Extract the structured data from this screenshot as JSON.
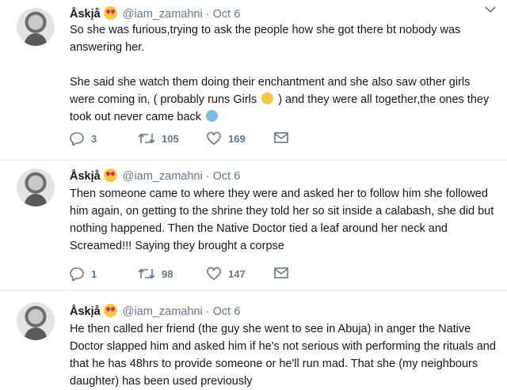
{
  "tweets": [
    {
      "name": "Åskįå",
      "handle": "@iam_zamahni",
      "dot": "·",
      "date": "Oct 6",
      "text1": "So she was furious,trying to ask the people how she got there bt nobody was answering her.",
      "text2a": "She said she watch them doing their enchantment and she also saw other girls were coming in, ( probably runs Girls",
      "text2b": ") and they were all together,the ones they took out never came back",
      "replies": "3",
      "retweets": "105",
      "likes": "169"
    },
    {
      "name": "Åskįå",
      "handle": "@iam_zamahni",
      "dot": "·",
      "date": "Oct 6",
      "text1": "Then someone came to where they were and asked her to follow him she followed him again, on getting to the shrine they told her so sit inside a calabash, she did but nothing happened. Then the Native Doctor tied a leaf around her neck and Screamed!!! Saying they brought a corpse",
      "replies": "1",
      "retweets": "98",
      "likes": "147"
    },
    {
      "name": "Åskįå",
      "handle": "@iam_zamahni",
      "dot": "·",
      "date": "Oct 6",
      "text1": "He then called her friend (the guy she went to see in Abuja) in anger the Native Doctor slapped him and asked him if he's not serious with performing the rituals and that he has 48hrs to provide someone or he'll run mad. That she (my neighbours daughter) has been used previously"
    }
  ],
  "icons": {
    "heart_eyes": "heart-eyes-emoji",
    "confused": "confused-emoji",
    "crying": "loudly-crying-emoji",
    "reply": "reply-icon",
    "retweet": "retweet-icon",
    "like": "heart-icon",
    "dm": "envelope-icon",
    "caret": "chevron-down-icon"
  },
  "colors": {
    "text": "#14171a",
    "secondary": "#657786",
    "divider": "#e6ecf0"
  }
}
